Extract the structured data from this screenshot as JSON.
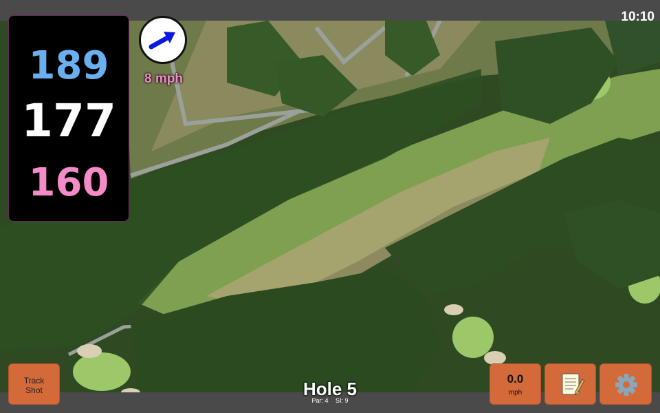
{
  "status_bar": {
    "time": "10:10"
  },
  "distances": {
    "back": "189",
    "middle": "177",
    "front": "160"
  },
  "wind": {
    "speed_label": "8 mph",
    "direction_icon": "arrow-up-right-icon"
  },
  "buttons": {
    "track_shot": "Track\nShot",
    "wind_value": "0.0",
    "wind_unit": "mph",
    "notes_icon": "notepad-icon",
    "settings_icon": "gear-icon"
  },
  "hole": {
    "title": "Hole 5",
    "par": "Par: 4",
    "si": "SI: 9"
  },
  "colors": {
    "back": "#6ab0f0",
    "middle": "#ffffff",
    "front": "#f58bc7",
    "button": "#d4693a",
    "bar": "#4a4a4a"
  }
}
